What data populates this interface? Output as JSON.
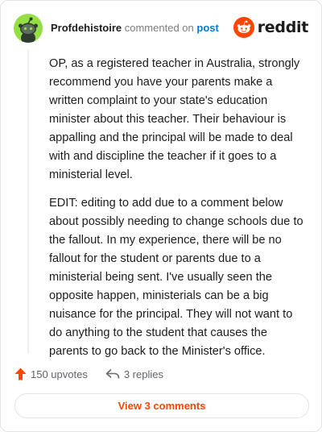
{
  "comment": {
    "author": "Profdehistoire",
    "action_text": "commented on",
    "target_link": "post",
    "brand": "reddit",
    "paragraphs": [
      "OP, as a registered teacher in Australia, strongly recommend you have your parents make a written complaint to your state's education minister about this teacher. Their behaviour is appalling and the principal will be made to deal with and discipline the teacher if it goes to a ministerial level.",
      "EDIT: editing to add due to a comment below about possibly needing to change schools due to the fallout. In my experience, there will be no fallout for the student or parents due to a ministerial being sent. I've usually seen the opposite happen, ministerials can be a big nuisance for the principal. They will not want to do anything to the student that causes the parents to go back to the Minister's office."
    ],
    "upvotes": "150 upvotes",
    "replies": "3 replies",
    "view_comments": "View 3 comments"
  },
  "icons": {
    "avatar": "snoo-avatar-icon",
    "brand": "reddit-logo-icon",
    "upvote": "upvote-arrow-icon",
    "reply": "reply-arrow-icon"
  },
  "colors": {
    "accent": "#ff4500",
    "link": "#0079d3",
    "avatar_bg": "#94e044"
  }
}
